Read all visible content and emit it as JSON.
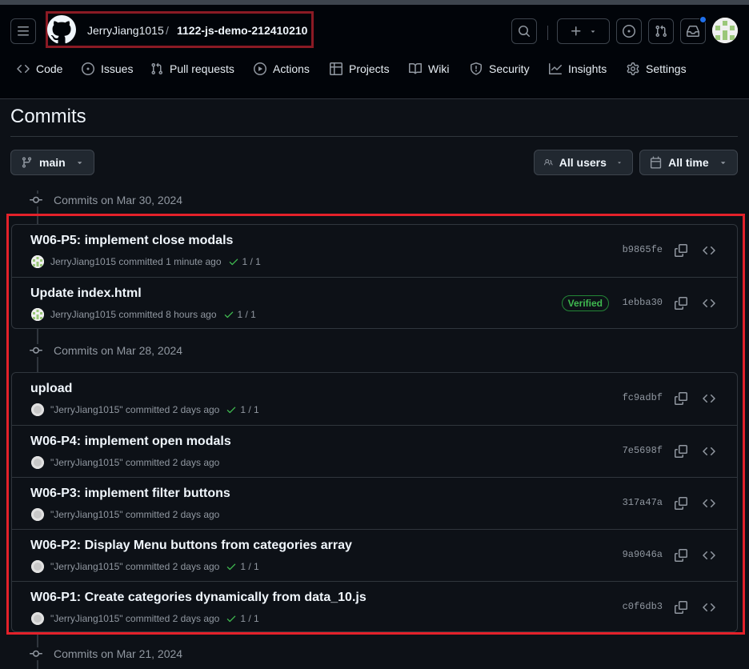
{
  "header": {
    "owner": "JerryJiang1015",
    "separator": "/",
    "repo": "1122-js-demo-212410210"
  },
  "nav": {
    "tabs": [
      {
        "label": "Code",
        "icon": "code-icon"
      },
      {
        "label": "Issues",
        "icon": "issue-opened-icon"
      },
      {
        "label": "Pull requests",
        "icon": "git-pull-request-icon"
      },
      {
        "label": "Actions",
        "icon": "play-icon"
      },
      {
        "label": "Projects",
        "icon": "table-icon"
      },
      {
        "label": "Wiki",
        "icon": "book-icon"
      },
      {
        "label": "Security",
        "icon": "shield-icon"
      },
      {
        "label": "Insights",
        "icon": "graph-icon"
      },
      {
        "label": "Settings",
        "icon": "gear-icon"
      }
    ]
  },
  "page": {
    "title": "Commits",
    "branch": "main",
    "users_filter": "All users",
    "time_filter": "All time"
  },
  "groups": [
    {
      "heading": "Commits on Mar 30, 2024",
      "commits": [
        {
          "title": "W06-P5: implement close modals",
          "author": "JerryJiang1015",
          "action": "committed",
          "time": "1 minute ago",
          "checks": "1 / 1",
          "verified": "",
          "sha": "b9865fe"
        },
        {
          "title": "Update index.html",
          "author": "JerryJiang1015",
          "action": "committed",
          "time": "8 hours ago",
          "checks": "1 / 1",
          "verified": "Verified",
          "sha": "1ebba30"
        }
      ]
    },
    {
      "heading": "Commits on Mar 28, 2024",
      "commits": [
        {
          "title": "upload",
          "author": "\"JerryJiang1015\"",
          "action": "committed",
          "time": "2 days ago",
          "checks": "1 / 1",
          "verified": "",
          "sha": "fc9adbf"
        },
        {
          "title": "W06-P4: implement open modals",
          "author": "\"JerryJiang1015\"",
          "action": "committed",
          "time": "2 days ago",
          "checks": "",
          "verified": "",
          "sha": "7e5698f"
        },
        {
          "title": "W06-P3: implement filter buttons",
          "author": "\"JerryJiang1015\"",
          "action": "committed",
          "time": "2 days ago",
          "checks": "",
          "verified": "",
          "sha": "317a47a"
        },
        {
          "title": "W06-P2: Display Menu buttons from categories array",
          "author": "\"JerryJiang1015\"",
          "action": "committed",
          "time": "2 days ago",
          "checks": "1 / 1",
          "verified": "",
          "sha": "9a9046a"
        },
        {
          "title": "W06-P1: Create categories dynamically from data_10.js",
          "author": "\"JerryJiang1015\"",
          "action": "committed",
          "time": "2 days ago",
          "checks": "1 / 1",
          "verified": "",
          "sha": "c0f6db3"
        }
      ]
    },
    {
      "heading": "Commits on Mar 21, 2024",
      "commits": []
    }
  ],
  "colors": {
    "background": "#0d1117",
    "header_bg": "#010409",
    "border": "#30363d",
    "success": "#3fb950",
    "highlight_red": "#e3212a",
    "highlight_dark_red": "#8b1a24",
    "accent_blue": "#1f6feb"
  }
}
